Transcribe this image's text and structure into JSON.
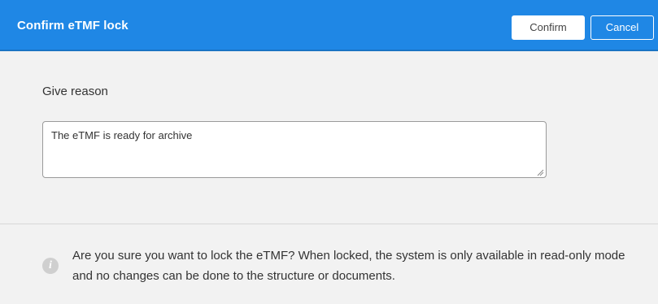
{
  "dialog": {
    "title": "Confirm eTMF lock",
    "confirm_label": "Confirm",
    "cancel_label": "Cancel"
  },
  "form": {
    "reason_label": "Give reason",
    "reason_value": "The eTMF is ready for archive"
  },
  "info": {
    "icon": "info-icon",
    "message": "Are you sure you want to lock the eTMF? When locked, the system is only available in read-only mode and no changes can be done to the structure or documents."
  },
  "colors": {
    "header_bg": "#1f87e5",
    "body_bg": "#f2f2f2"
  }
}
